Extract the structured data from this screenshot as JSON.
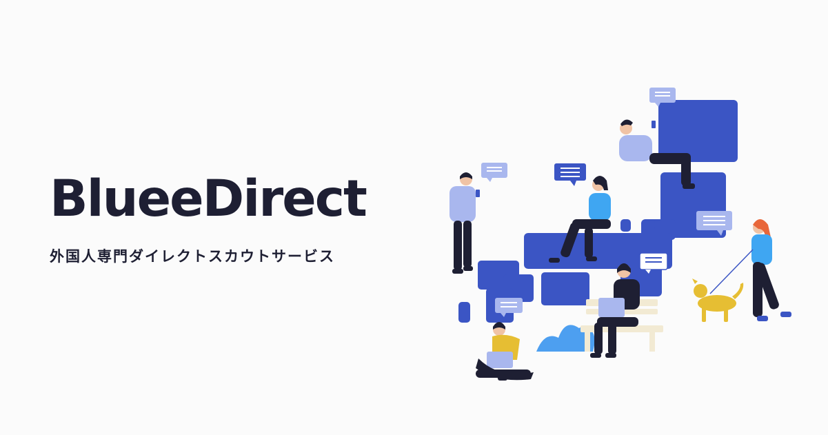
{
  "brand": {
    "logo_text": "BlueeDirect",
    "tagline": "外国人専門ダイレクトスカウトサービス"
  },
  "colors": {
    "background": "#fbfbfb",
    "text": "#1e1f33",
    "map_blue": "#3b55c4",
    "bubble_light": "#a9b7ee",
    "bubble_dark": "#3b55c4",
    "accent_yellow": "#e6be33",
    "accent_cyan": "#3fa6f2",
    "shrub": "#4d9ff0"
  },
  "illustration": {
    "icon": "japan-map-people-illustration"
  }
}
